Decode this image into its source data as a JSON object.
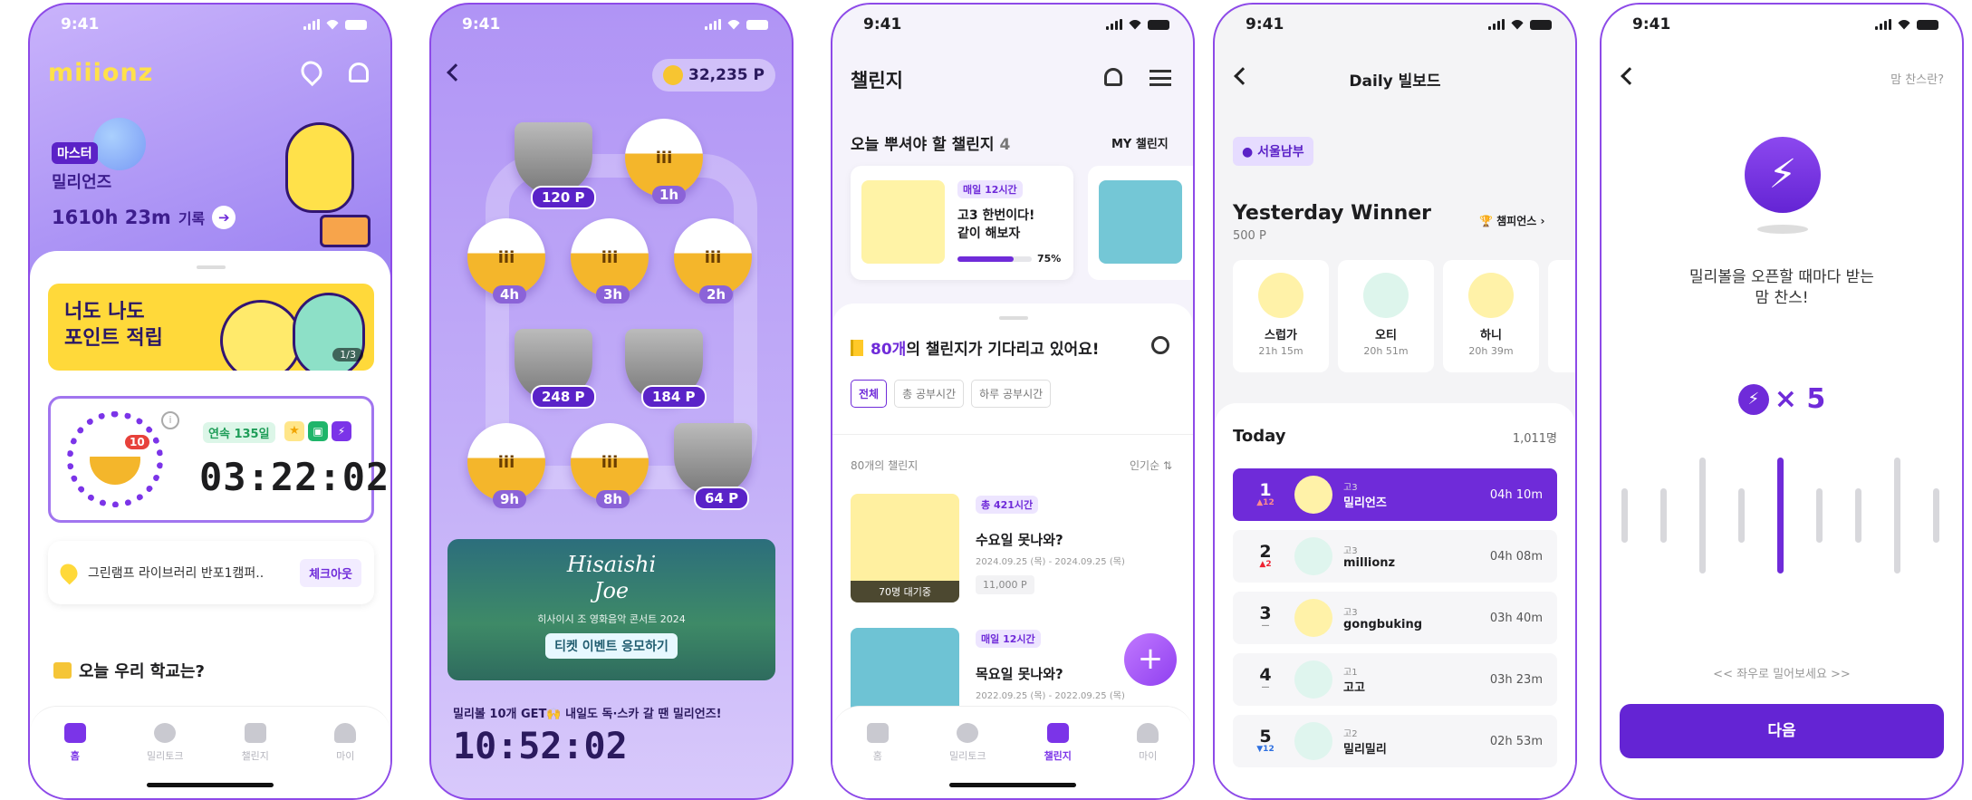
{
  "status_time": "9:41",
  "s1": {
    "logo": "miiionz",
    "badge": "마스터",
    "user": "밀리언즈",
    "record_time": "1610h 23m",
    "record_label": "기록",
    "banner_line1": "너도 나도",
    "banner_line2": "포인트 적립",
    "banner_page": "1/3",
    "timer_notif": "10",
    "streak": "연속 135일",
    "timer": "03:22:02",
    "location": "그린램프 라이브러리 반포1캠퍼..",
    "checkout": "체크아웃",
    "school": "오늘 우리 학교는?",
    "nav": [
      "홈",
      "밀리토크",
      "챌린지",
      "마이"
    ]
  },
  "s2": {
    "points": "32,235 P",
    "rewards": [
      "120 P",
      "1h",
      "4h",
      "3h",
      "2h",
      "248 P",
      "184 P",
      "9h",
      "8h",
      "64 P"
    ],
    "concert_script1": "Hisaishi",
    "concert_script2": "Joe",
    "concert_title": "히사이시 조 영화음악 콘서트 2024",
    "ticket": "티켓 이벤트 응모하기",
    "promo": "밀리볼 10개 GET🙌 내일도 독·스카 갈 땐 밀리언즈!",
    "countdown": "10:52:02"
  },
  "s3": {
    "title": "챌린지",
    "today_label": "오늘 뿌셔야 할 챌린지",
    "today_count": "4",
    "my": "MY 챌린지",
    "card_tag": "매일 12시간",
    "card_title1": "고3 한번이다!",
    "card_title2": "같이 해보자",
    "card_pct": "75%",
    "waiting_count": "80개",
    "waiting_rest": "의 챌린지가 기다리고 있어요!",
    "filters": [
      "전체",
      "총 공부시간",
      "하루 공부시간"
    ],
    "list_count": "80개의 챌린지",
    "sort": "인기순",
    "items": [
      {
        "tag": "총 421시간",
        "title": "수요일 못나와?",
        "date": "2024.09.25 (목) - 2024.09.25 (목)",
        "pts": "11,000 P",
        "wait": "70명 대기중"
      },
      {
        "tag": "매일 12시간",
        "title": "목요일 못나와?",
        "date": "2022.09.25 (목) - 2022.09.25 (목)"
      }
    ],
    "nav": [
      "홈",
      "밀리토크",
      "챌린지",
      "마이"
    ]
  },
  "s4": {
    "title": "Daily 빌보드",
    "region": "서울남부",
    "winner": "Yesterday Winner",
    "winner_pts": "500 P",
    "champions": "챔피언스",
    "winners": [
      {
        "name": "스럽가",
        "time": "21h 15m"
      },
      {
        "name": "오티",
        "time": "20h 51m"
      },
      {
        "name": "하니",
        "time": "20h 39m"
      }
    ],
    "today": "Today",
    "today_count": "1,011명",
    "rows": [
      {
        "rank": "1",
        "delta": "▲12",
        "grade": "고3",
        "name": "밀리언즈",
        "time": "04h 10m"
      },
      {
        "rank": "2",
        "delta": "▲2",
        "grade": "고3",
        "name": "millionz",
        "time": "04h 08m"
      },
      {
        "rank": "3",
        "delta": "—",
        "grade": "고3",
        "name": "gongbuking",
        "time": "03h 40m"
      },
      {
        "rank": "4",
        "delta": "—",
        "grade": "고1",
        "name": "고고",
        "time": "03h 23m"
      },
      {
        "rank": "5",
        "delta": "▼12",
        "grade": "고2",
        "name": "밀리밀리",
        "time": "02h 53m"
      }
    ]
  },
  "s5": {
    "help": "맘 찬스란?",
    "msg1": "밀리볼을 오픈할 때마다 받는",
    "msg2": "맘 찬스!",
    "mult": "× 5",
    "hint": "<< 좌우로 밀어보세요 >>",
    "next": "다음"
  },
  "colors": {
    "accent": "#6f2bd9",
    "yellow": "#ffd93a",
    "lavender": "#b79ef5"
  }
}
